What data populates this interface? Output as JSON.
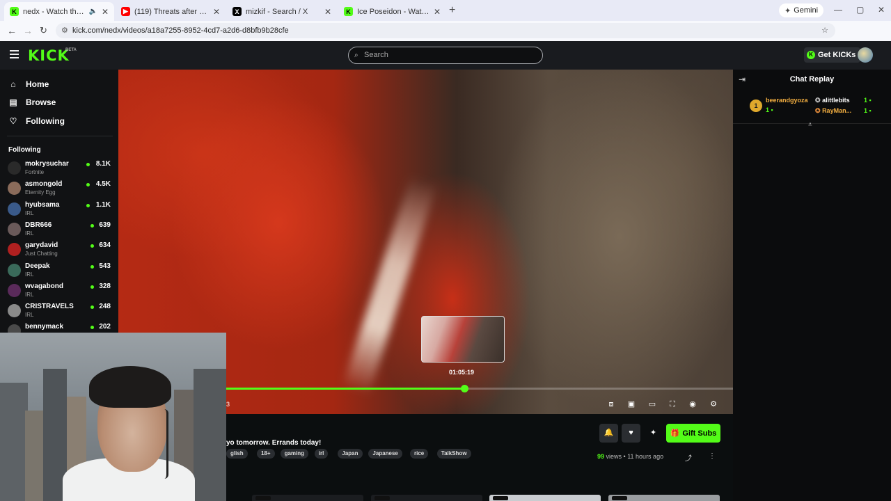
{
  "browser": {
    "tabs": [
      {
        "title": "nedx - Watch the VOD on",
        "active": true
      },
      {
        "title": "(119) Threats after being assau",
        "active": false
      },
      {
        "title": "mizkif - Search / X",
        "active": false
      },
      {
        "title": "Ice Poseidon - Watch clips on",
        "active": false
      }
    ],
    "gemini_label": "Gemini",
    "url": "kick.com/nedx/videos/a18a7255-8952-4cd7-a2d6-d8bfb9b28cfe"
  },
  "header": {
    "logo": "KICK",
    "beta": "BETA",
    "search_placeholder": "Search",
    "get_kicks": "Get KICKs"
  },
  "sidebar": {
    "nav": [
      {
        "label": "Home",
        "icon": "home-icon"
      },
      {
        "label": "Browse",
        "icon": "browse-icon"
      },
      {
        "label": "Following",
        "icon": "heart-icon"
      }
    ],
    "following_heading": "Following",
    "channels": [
      {
        "name": "mokrysuchar",
        "category": "Fortnite",
        "viewers": "8.1K",
        "color": "#2a2a2a"
      },
      {
        "name": "asmongold",
        "category": "Eternity Egg",
        "viewers": "4.5K",
        "color": "#8a6b5a"
      },
      {
        "name": "hyubsama",
        "category": "IRL",
        "viewers": "1.1K",
        "color": "#3a5a8a"
      },
      {
        "name": "DBR666",
        "category": "IRL",
        "viewers": "639",
        "color": "#6a5a5a"
      },
      {
        "name": "garydavid",
        "category": "Just Chatting",
        "viewers": "634",
        "color": "#b02020"
      },
      {
        "name": "Deepak",
        "category": "IRL",
        "viewers": "543",
        "color": "#3a6a5a"
      },
      {
        "name": "wvagabond",
        "category": "IRL",
        "viewers": "328",
        "color": "#5a2a5a"
      },
      {
        "name": "CRISTRAVELS",
        "category": "IRL",
        "viewers": "248",
        "color": "#8a8a8a"
      },
      {
        "name": "bennymack",
        "category": "Just Chatting",
        "viewers": "202",
        "color": "#4a4a4a"
      }
    ]
  },
  "player": {
    "preview_time": "01:05:19",
    "progress_fraction": 0.47,
    "time_fragment": "3"
  },
  "chat": {
    "title": "Chat Replay",
    "gifters": [
      {
        "rank": "1",
        "name": "beerandgyoza",
        "count": "1"
      },
      {
        "name": "alittlebits",
        "count": "1"
      },
      {
        "name": "RayMan...",
        "count": "1"
      }
    ]
  },
  "stream": {
    "title": "yo tomorrow. Errands today!",
    "tags": [
      "glish",
      "18+",
      "gaming",
      "irl",
      "Japan",
      "Japanese",
      "rice",
      "TalkShow"
    ],
    "gift_subs": "Gift Subs",
    "views_count": "99",
    "views_label": "views",
    "age": "11 hours ago"
  }
}
